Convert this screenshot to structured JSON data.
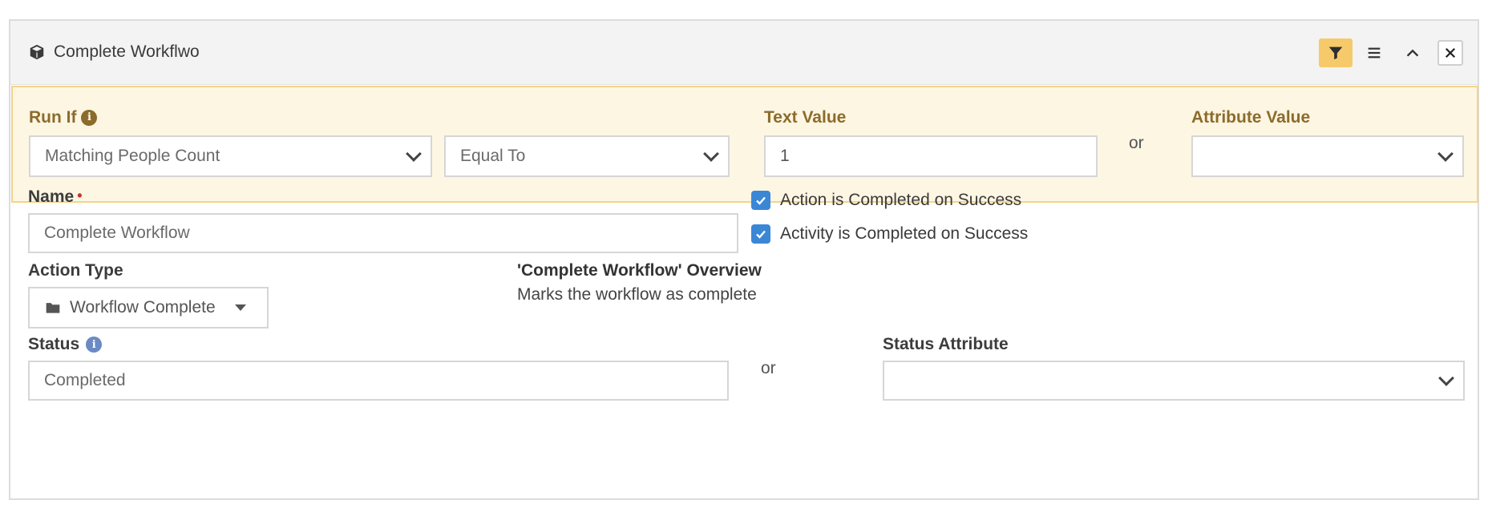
{
  "header": {
    "title": "Complete Workflwo",
    "title_icon": "cube-icon",
    "actions": [
      "filter-icon",
      "menu-icon",
      "chevron-up-icon",
      "close-icon"
    ]
  },
  "run_if": {
    "label": "Run If",
    "info_icon": "info-icon",
    "condition_value": "Matching People Count",
    "operator_value": "Equal To",
    "text_value_label": "Text Value",
    "text_value": "1",
    "or_text": "or",
    "attribute_value_label": "Attribute Value",
    "attribute_value": ""
  },
  "form": {
    "name_label": "Name",
    "required_mark": "•",
    "name_value": "Complete Workflow",
    "checkbox_action_label": "Action is Completed on Success",
    "checkbox_action_checked": true,
    "checkbox_activity_label": "Activity is Completed on Success",
    "checkbox_activity_checked": true,
    "action_type_label": "Action Type",
    "action_type_value": "Workflow Complete",
    "overview_title": "'Complete Workflow' Overview",
    "overview_text": "Marks the workflow as complete",
    "status_label": "Status",
    "status_value": "Completed",
    "or_text": "or",
    "status_attribute_label": "Status Attribute",
    "status_attribute_value": ""
  },
  "colors": {
    "filter_accent": "#f6c96b",
    "runif_bg": "#fdf6e3",
    "runif_border": "#f4d38a",
    "runif_label": "#8c6b2b",
    "checkbox": "#3a87d6",
    "required": "#c0392b"
  }
}
